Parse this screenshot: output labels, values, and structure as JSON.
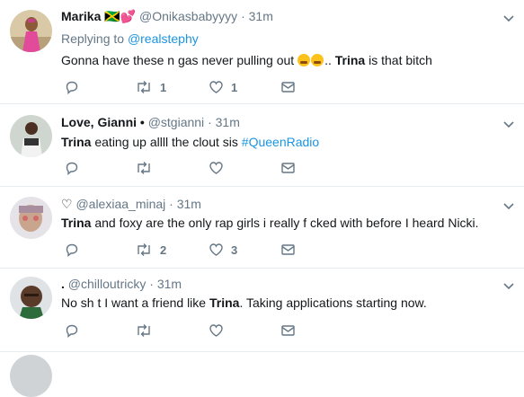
{
  "tweets": [
    {
      "name": "Marika 🇯🇲💕",
      "handle": "@Onikasbabyyyy",
      "sep": "·",
      "time": "31m",
      "reply_prefix": "Replying to ",
      "reply_to": "@realstephy",
      "text_a": "Gonna have these n gas never pulling out ",
      "text_b": ".. ",
      "text_bold": "Trina",
      "text_c": " is that bitch",
      "retweets": "1",
      "likes": "1"
    },
    {
      "name": "Love, Gianni",
      "badge": "•",
      "handle": "@stgianni",
      "sep": "·",
      "time": "31m",
      "text_bold": "Trina",
      "text_c": " eating up allll the clout sis ",
      "hashtag": "#QueenRadio"
    },
    {
      "name": "♡",
      "handle": "@alexiaa_minaj",
      "sep": "·",
      "time": "31m",
      "text_bold": "Trina",
      "text_c": " and foxy are the only rap girls i really f  cked with before I heard Nicki.",
      "retweets": "2",
      "likes": "3"
    },
    {
      "name": ".",
      "handle": "@chilloutricky",
      "sep": "·",
      "time": "31m",
      "text_a": "No sh  t I want a friend like ",
      "text_bold": "Trina",
      "text_c": ". Taking applications starting now."
    }
  ]
}
